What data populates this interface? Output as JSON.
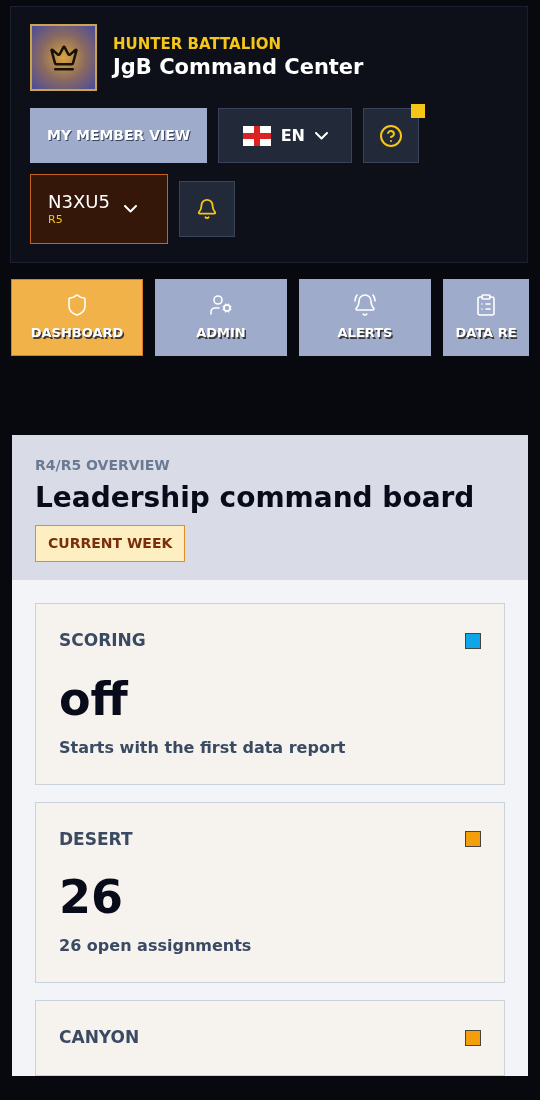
{
  "header": {
    "subtitle": "HUNTER BATTALION",
    "title": "JgB Command Center",
    "member_view_button": "MY MEMBER VIEW",
    "language": {
      "code": "EN"
    },
    "help": {
      "badge": true
    },
    "user": {
      "name": "N3XU5",
      "rank": "R5"
    }
  },
  "tabs": [
    {
      "label": "DASHBOARD",
      "selected": true
    },
    {
      "label": "ADMIN",
      "selected": false
    },
    {
      "label": "ALERTS",
      "selected": false
    },
    {
      "label": "DATA RE",
      "selected": false
    }
  ],
  "overview": {
    "eyebrow": "R4/R5 OVERVIEW",
    "title": "Leadership command board",
    "badge": "CURRENT WEEK",
    "cards": [
      {
        "label": "SCORING",
        "value": "off",
        "note": "Starts with the first data report",
        "color": "#0ea5e9"
      },
      {
        "label": "DESERT",
        "value": "26",
        "note": "26 open assignments",
        "color": "#f59e0b"
      },
      {
        "label": "CANYON",
        "color": "#f59e0b"
      }
    ]
  }
}
